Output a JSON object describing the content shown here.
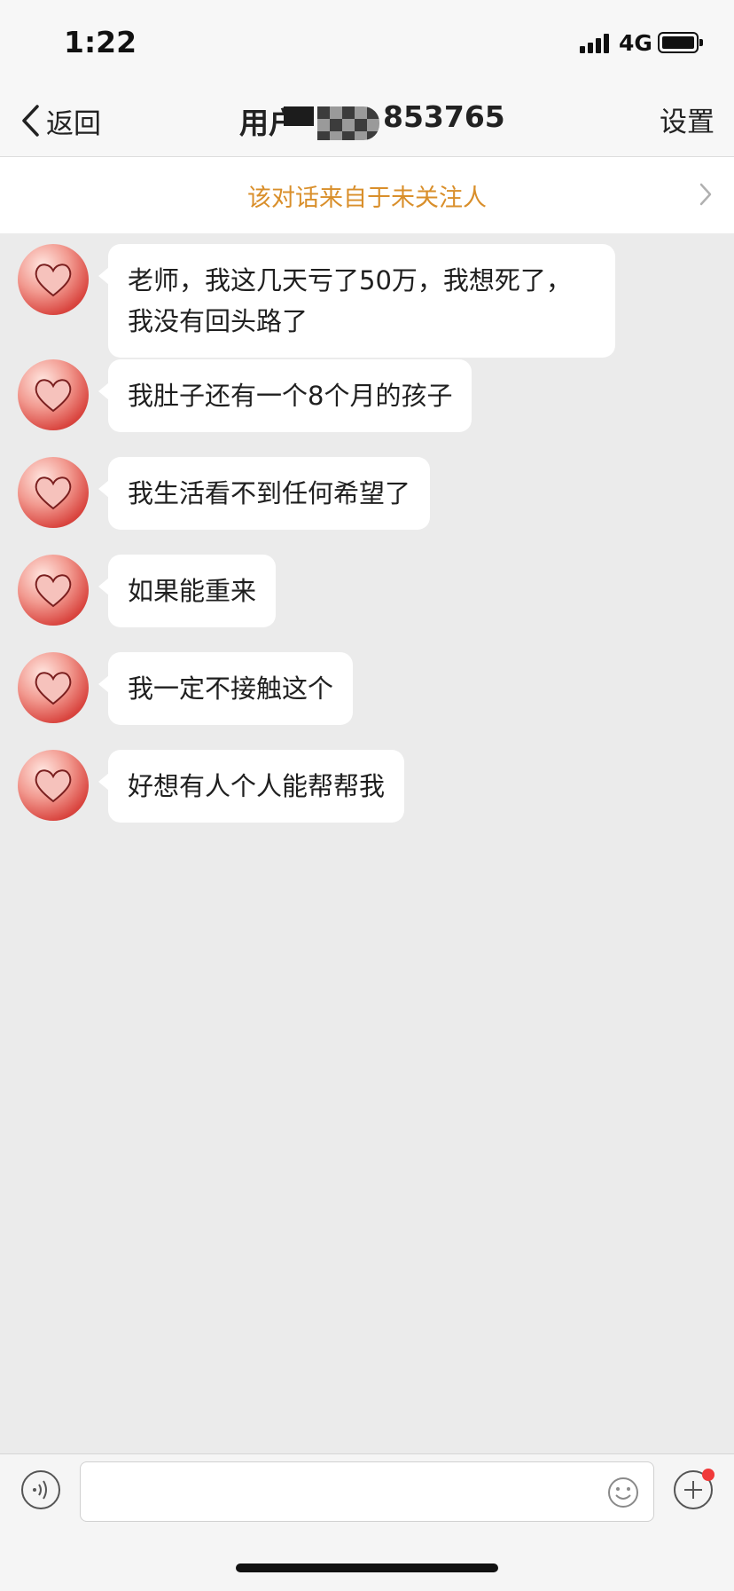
{
  "status_bar": {
    "time": "1:22",
    "network": "4G"
  },
  "nav": {
    "back_label": "返回",
    "title_prefix": "用户",
    "title_suffix": "853765",
    "settings_label": "设置"
  },
  "notice": {
    "text": "该对话来自于未关注人",
    "color": "#d98f2b"
  },
  "messages": [
    {
      "text": "老师，我这几天亏了50万，我想死了，我没有回头路了"
    },
    {
      "text": "我肚子还有一个8个月的孩子"
    },
    {
      "text": "我生活看不到任何希望了"
    },
    {
      "text": "如果能重来"
    },
    {
      "text": "我一定不接触这个"
    },
    {
      "text": "好想有人个人能帮帮我"
    }
  ],
  "input": {
    "placeholder": ""
  },
  "colors": {
    "background": "#ebebeb",
    "bubble": "#ffffff",
    "badge": "#f03a3a"
  },
  "icons": {
    "back": "chevron-left-icon",
    "notice": "chevron-right-icon",
    "voice": "voice-icon",
    "emoji": "emoji-icon",
    "plus": "plus-icon"
  }
}
